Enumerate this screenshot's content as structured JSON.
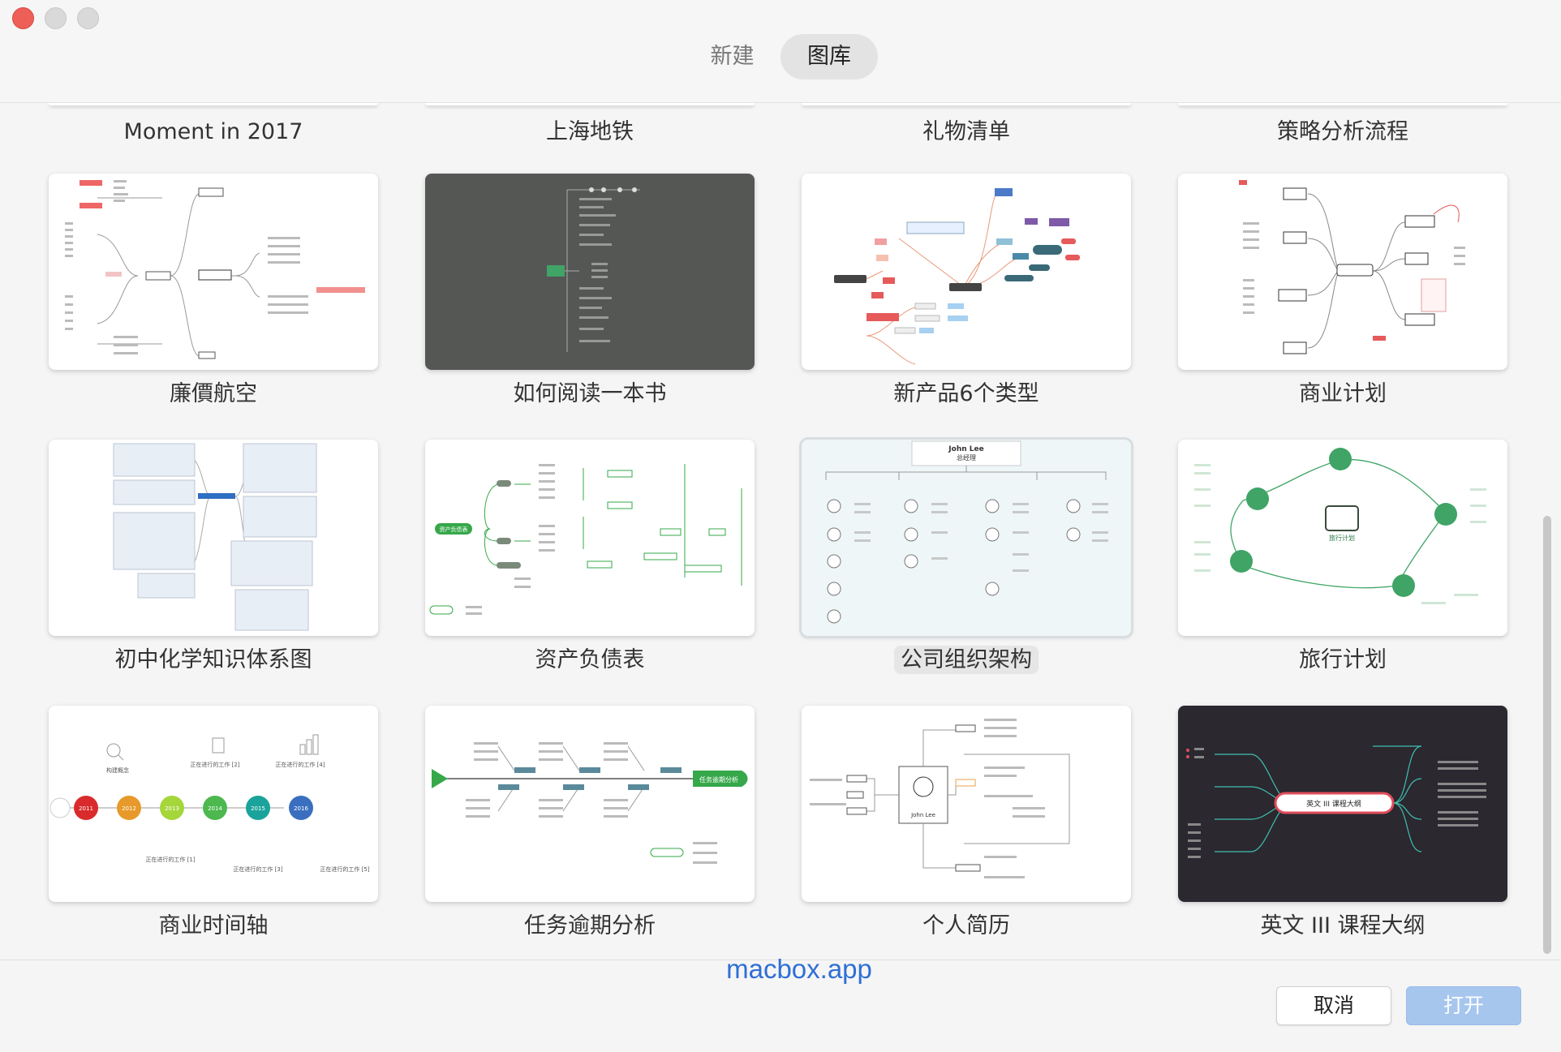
{
  "window": {
    "segments": {
      "new_label": "新建",
      "library_label": "图库"
    }
  },
  "gallery": {
    "top_row_labels": [
      "Moment in 2017",
      "上海地铁",
      "礼物清单",
      "策略分析流程"
    ],
    "rows": [
      [
        "廉價航空",
        "如何阅读一本书",
        "新产品6个类型",
        "商业计划"
      ],
      [
        "初中化学知识体系图",
        "资产负债表",
        "公司组织架构",
        "旅行计划"
      ],
      [
        "商业时间轴",
        "任务逾期分析",
        "个人简历",
        "英文 III 课程大纲"
      ]
    ],
    "selected": "公司组织架构"
  },
  "previews": {
    "org_chart_title": "John Lee",
    "org_chart_subtitle": "总经理",
    "travel_center": "旅行计划",
    "balance_root": "资产负债表",
    "timeline_years": [
      "2011",
      "2012",
      "2013",
      "2014",
      "2015",
      "2016"
    ],
    "timeline_labels_top": [
      "构建概念",
      "正在进行的工作 [2]",
      "正在进行的工作 [4]"
    ],
    "timeline_labels_bottom": [
      "正在进行的工作 [1]",
      "正在进行的工作 [3]",
      "正在进行的工作 [5]"
    ],
    "task_head": "任务逾期分析",
    "resume_name": "John Lee",
    "syllabus_center": "英文 III 课程大纲",
    "colors": {
      "timeline": [
        "#d92b2b",
        "#e79a2b",
        "#a5d63a",
        "#4cb84f",
        "#1aa39a",
        "#3a6fc0"
      ],
      "green": "#36a84a",
      "travel_green": "#3fa466",
      "syllabus_red": "#e04d5a"
    }
  },
  "watermark": "macbox.app",
  "buttons": {
    "cancel": "取消",
    "open": "打开"
  }
}
